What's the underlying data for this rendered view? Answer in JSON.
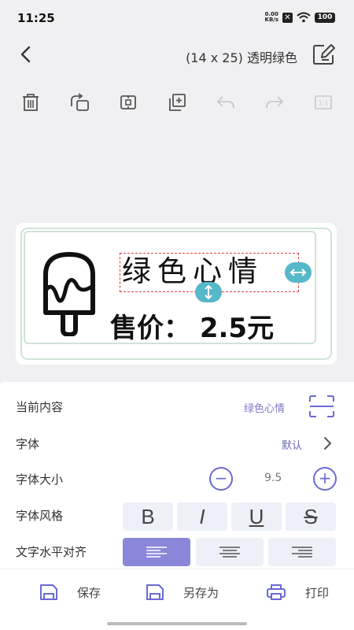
{
  "status": {
    "time": "11:25",
    "net_speed_top": "0.00",
    "net_speed_bottom": "KB/s",
    "battery": "100"
  },
  "header": {
    "title": "(14 x 25)  透明绿色"
  },
  "toolbar": {
    "icons": [
      "trash-icon",
      "rotate-icon",
      "center-icon",
      "copy-icon",
      "undo-icon",
      "redo-icon",
      "one-to-one-icon"
    ]
  },
  "label": {
    "text": "绿色心情",
    "price": "售价：  2.5元"
  },
  "panel": {
    "content": {
      "label": "当前内容",
      "value": "绿色心情"
    },
    "font": {
      "label": "字体",
      "value": "默认"
    },
    "font_size": {
      "label": "字体大小",
      "value": "9.5",
      "minus": "−",
      "plus": "+"
    },
    "font_style": {
      "label": "字体风格",
      "bold": "B",
      "italic": "I",
      "underline": "U",
      "strike": "S"
    },
    "align": {
      "label": "文字水平对齐",
      "selected": "left"
    }
  },
  "bottom": {
    "save": "保存",
    "save_as": "另存为",
    "print": "打印"
  },
  "colors": {
    "accent": "#8a86d9",
    "handle": "#56b8c8",
    "dashed": "#e24040",
    "border_green": "#cfe3d6"
  }
}
